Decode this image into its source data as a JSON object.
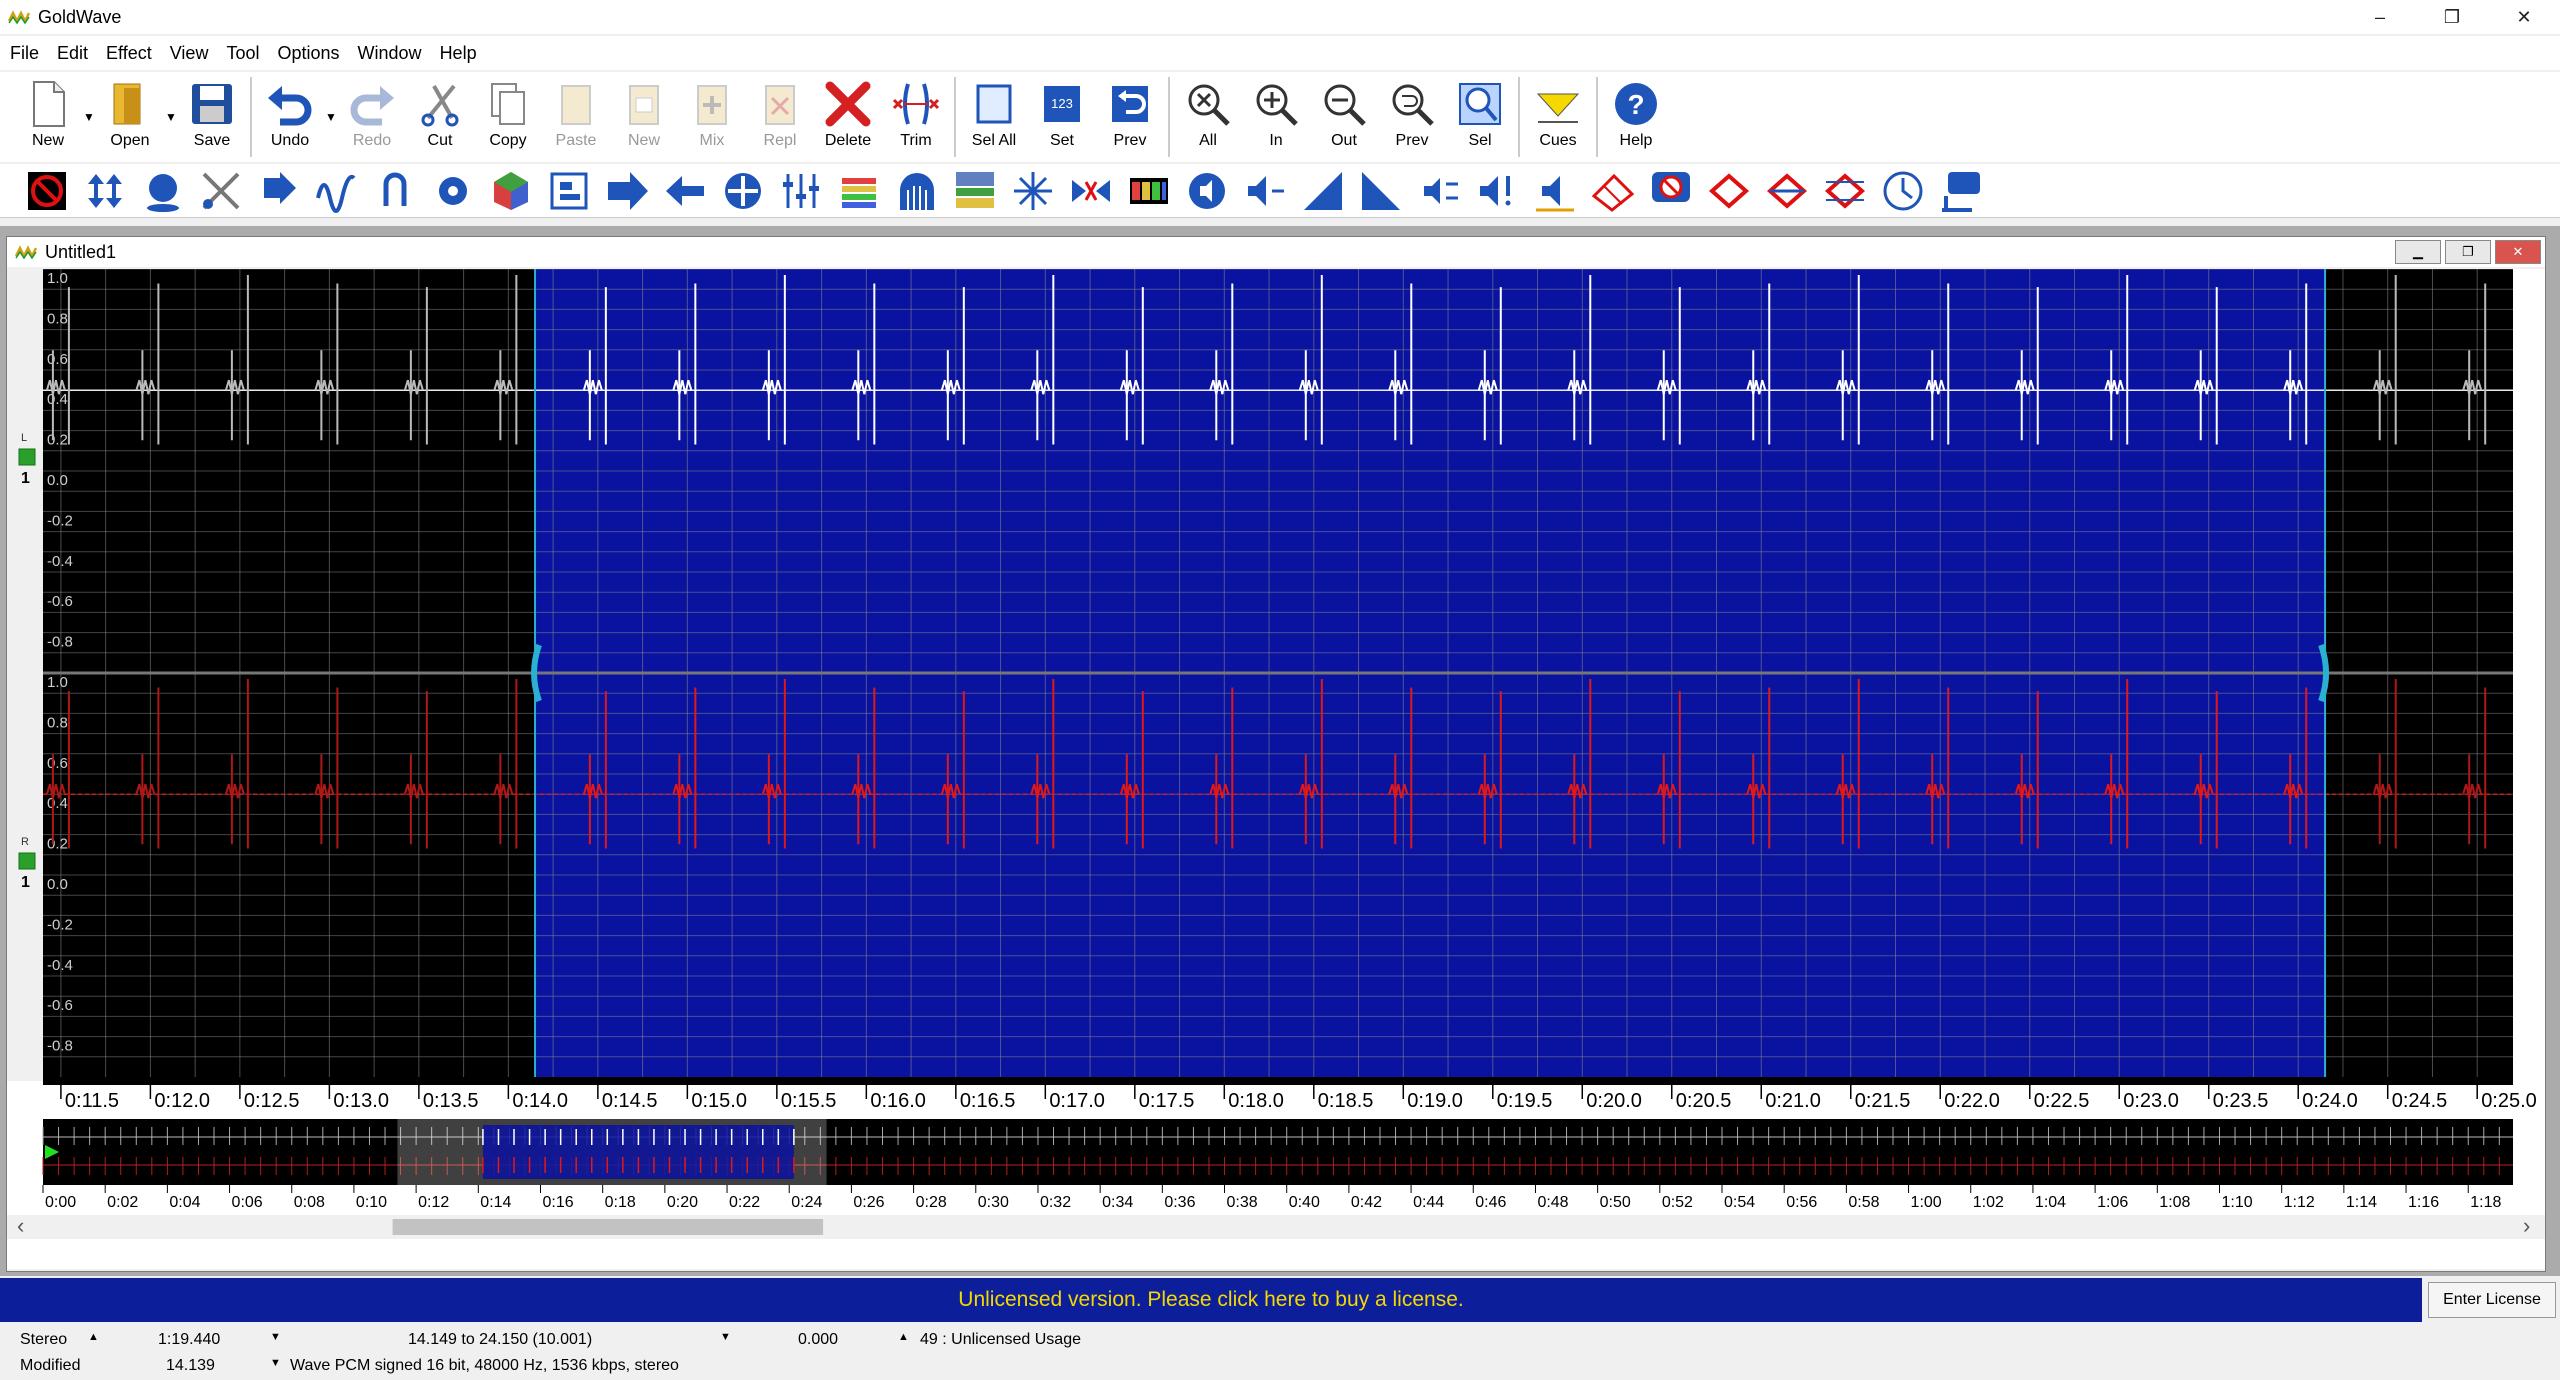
{
  "window": {
    "title": "GoldWave",
    "minimize": "–",
    "restore": "❐",
    "close": "✕"
  },
  "menu": [
    "File",
    "Edit",
    "Effect",
    "View",
    "Tool",
    "Options",
    "Window",
    "Help"
  ],
  "toolbar": {
    "new": "New",
    "open": "Open",
    "save": "Save",
    "undo": "Undo",
    "redo": "Redo",
    "cut": "Cut",
    "copy": "Copy",
    "paste": "Paste",
    "new2": "New",
    "mix": "Mix",
    "repl": "Repl",
    "delete": "Delete",
    "trim": "Trim",
    "sel_all": "Sel All",
    "set": "Set",
    "prev": "Prev",
    "all": "All",
    "in": "In",
    "out": "Out",
    "prev2": "Prev",
    "sel": "Sel",
    "cues": "Cues",
    "help": "Help"
  },
  "document": {
    "title": "Untitled1",
    "yticks_top": [
      "1.0",
      "0.8",
      "0.6",
      "0.4",
      "0.2",
      "0.0",
      "-0.2",
      "-0.4",
      "-0.6",
      "-0.8"
    ],
    "yticks_bottom": [
      "1.0",
      "0.8",
      "0.6",
      "0.4",
      "0.2",
      "0.0",
      "-0.2",
      "-0.4",
      "-0.6",
      "-0.8"
    ],
    "channel_left": "L",
    "channel_right": "R",
    "channel_num": "1",
    "time_labels": [
      "0:11.5",
      "0:12.0",
      "0:12.5",
      "0:13.0",
      "0:13.5",
      "0:14.0",
      "0:14.5",
      "0:15.0",
      "0:15.5",
      "0:16.0",
      "0:16.5",
      "0:17.0",
      "0:17.5",
      "0:18.0",
      "0:18.5",
      "0:19.0",
      "0:19.5",
      "0:20.0",
      "0:20.5",
      "0:21.0",
      "0:21.5",
      "0:22.0",
      "0:22.5",
      "0:23.0",
      "0:23.5",
      "0:24.0",
      "0:24.5",
      "0:25.0"
    ],
    "overview_labels": [
      "0:00",
      "0:02",
      "0:04",
      "0:06",
      "0:08",
      "0:10",
      "0:12",
      "0:14",
      "0:16",
      "0:18",
      "0:20",
      "0:22",
      "0:24",
      "0:26",
      "0:28",
      "0:30",
      "0:32",
      "0:34",
      "0:36",
      "0:38",
      "0:40",
      "0:42",
      "0:44",
      "0:46",
      "0:48",
      "0:50",
      "0:52",
      "0:54",
      "0:56",
      "0:58",
      "1:00",
      "1:02",
      "1:04",
      "1:06",
      "1:08",
      "1:10",
      "1:12",
      "1:14",
      "1:16",
      "1:18"
    ],
    "view_start": 11.4,
    "view_end": 25.2,
    "selection_start": 14.149,
    "selection_end": 24.15,
    "total_length": 79.44
  },
  "colors": {
    "selection": "#0a12a0",
    "left_wave": "#ffffff",
    "right_wave": "#e01818",
    "background": "#000000"
  },
  "status": {
    "license_msg": "Unlicensed version. Please click here to buy a license.",
    "enter_license": "Enter License",
    "channels": "Stereo",
    "length": "1:19.440",
    "selection": "14.149 to 24.150 (10.001)",
    "position": "0.000",
    "usage": "49 : Unlicensed Usage",
    "modified": "Modified",
    "cursor": "14.139",
    "format": "Wave PCM signed 16 bit, 48000 Hz, 1536 kbps, stereo"
  }
}
